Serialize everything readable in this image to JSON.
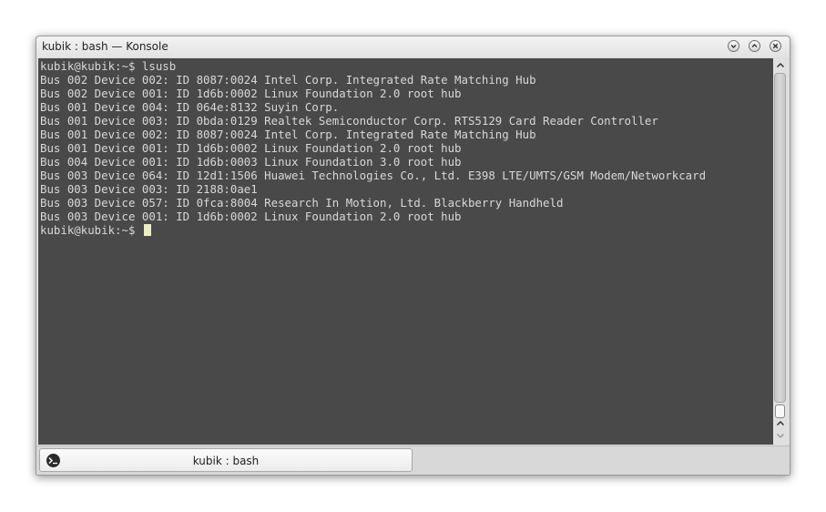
{
  "window": {
    "title": "kubik : bash — Konsole",
    "buttons": [
      "minimize",
      "maximize",
      "close"
    ]
  },
  "terminal": {
    "lines": [
      "kubik@kubik:~$ lsusb",
      "Bus 002 Device 002: ID 8087:0024 Intel Corp. Integrated Rate Matching Hub",
      "Bus 002 Device 001: ID 1d6b:0002 Linux Foundation 2.0 root hub",
      "Bus 001 Device 004: ID 064e:8132 Suyin Corp.",
      "Bus 001 Device 003: ID 0bda:0129 Realtek Semiconductor Corp. RTS5129 Card Reader Controller",
      "Bus 001 Device 002: ID 8087:0024 Intel Corp. Integrated Rate Matching Hub",
      "Bus 001 Device 001: ID 1d6b:0002 Linux Foundation 2.0 root hub",
      "Bus 004 Device 001: ID 1d6b:0003 Linux Foundation 3.0 root hub",
      "Bus 003 Device 064: ID 12d1:1506 Huawei Technologies Co., Ltd. E398 LTE/UMTS/GSM Modem/Networkcard",
      "Bus 003 Device 003: ID 2188:0ae1",
      "Bus 003 Device 057: ID 0fca:8004 Research In Motion, Ltd. Blackberry Handheld",
      "Bus 003 Device 001: ID 1d6b:0002 Linux Foundation 2.0 root hub"
    ],
    "prompt": "kubik@kubik:~$ ",
    "colors": {
      "background": "#494949",
      "foreground": "#d8d8d8",
      "cursor": "#ececc6"
    }
  },
  "tabs": [
    {
      "label": "kubik : bash",
      "icon": "terminal-icon",
      "active": true
    }
  ]
}
